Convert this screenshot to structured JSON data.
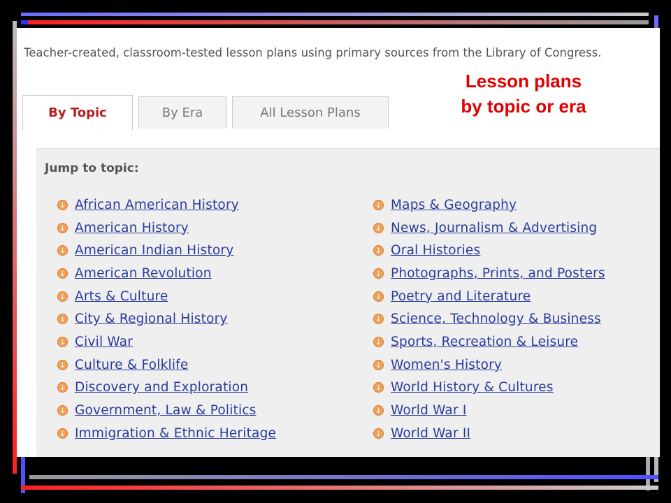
{
  "intro": "Teacher-created, classroom-tested lesson plans using primary sources from the Library of Congress.",
  "tabs": [
    "By Topic",
    "By Era",
    "All Lesson Plans"
  ],
  "callout": {
    "line1": "Lesson plans",
    "line2": "by topic or era"
  },
  "jump_label": "Jump to topic:",
  "topics_left": [
    "African American History",
    "American History",
    "American Indian History",
    "American Revolution",
    "Arts & Culture",
    "City & Regional History",
    "Civil War",
    "Culture & Folklife",
    "Discovery and Exploration",
    "Government, Law & Politics",
    "Immigration & Ethnic Heritage"
  ],
  "topics_right": [
    "Maps & Geography",
    "News, Journalism & Advertising",
    "Oral Histories",
    "Photographs, Prints, and Posters",
    "Poetry and Literature",
    "Science, Technology & Business",
    "Sports, Recreation & Leisure",
    "Women's History",
    "World History & Cultures",
    "World War I",
    "World War II"
  ],
  "icons": {
    "topic_bullet": "down-arrow-circle-icon"
  },
  "colors": {
    "link": "#2a3b9b",
    "active_tab": "#b41e1e",
    "callout": "#e00000",
    "bullet": "#f2a15a"
  }
}
